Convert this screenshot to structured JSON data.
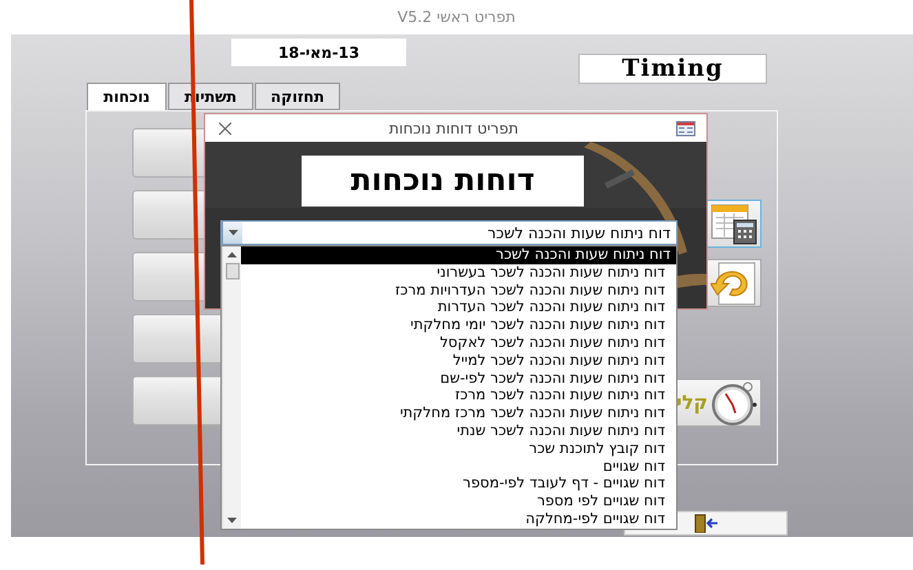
{
  "main_window": {
    "title": "תפריט ראשי V5.2",
    "date": "13-מאי-18",
    "logo": "Timing",
    "tabs": [
      {
        "label": "תחזוקה",
        "selected": false
      },
      {
        "label": "תשתיות",
        "selected": false
      },
      {
        "label": "נוכחות",
        "selected": true
      }
    ],
    "tool_buttons": [
      {
        "kind": "calculator"
      },
      {
        "kind": "undo"
      },
      {
        "kind": "clock",
        "label": "קלי"
      }
    ]
  },
  "dialog": {
    "title": "תפריט דוחות נוכחות",
    "heading": "דוחות נוכחות",
    "combo": {
      "value": "דוח ניתוח שעות והכנה לשכר",
      "expanded": true
    },
    "options": [
      {
        "label": "דוח ניתוח שעות והכנה לשכר",
        "selected": true
      },
      {
        "label": "דוח ניתוח שעות והכנה לשכר בעשרוני",
        "selected": false
      },
      {
        "label": "דוח ניתוח שעות והכנה לשכר העדרויות מרכז",
        "selected": false
      },
      {
        "label": "דוח ניתוח שעות והכנה לשכר העדרות",
        "selected": false
      },
      {
        "label": "דוח ניתוח שעות והכנה לשכר יומי מחלקתי",
        "selected": false
      },
      {
        "label": "דוח ניתוח שעות והכנה לשכר לאקסל",
        "selected": false
      },
      {
        "label": "דוח ניתוח שעות והכנה לשכר למייל",
        "selected": false
      },
      {
        "label": "דוח ניתוח שעות והכנה לשכר לפי-שם",
        "selected": false
      },
      {
        "label": "דוח ניתוח שעות והכנה לשכר מרכז",
        "selected": false
      },
      {
        "label": "דוח ניתוח שעות והכנה לשכר מרכז מחלקתי",
        "selected": false
      },
      {
        "label": "דוח ניתוח שעות והכנה לשכר שנתי",
        "selected": false
      },
      {
        "label": "דוח קובץ לתוכנת שכר",
        "selected": false
      },
      {
        "label": "דוח שגויים",
        "selected": false
      },
      {
        "label": "דוח שגויים - דף לעובד לפי-מספר",
        "selected": false
      },
      {
        "label": "דוח שגויים לפי מספר",
        "selected": false
      },
      {
        "label": "דוח שגויים לפי-מחלקה",
        "selected": false
      }
    ]
  }
}
